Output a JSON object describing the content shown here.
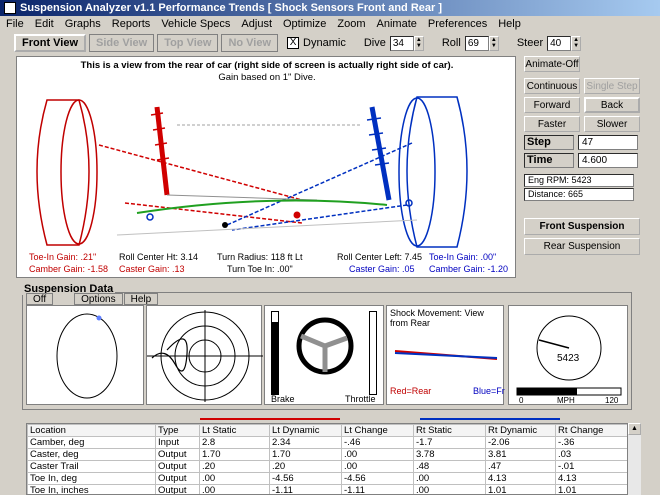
{
  "window": {
    "title": "Suspension Analyzer v1.1    Performance Trends   [ Shock Sensors Front and Rear ]"
  },
  "menu": [
    "File",
    "Edit",
    "Graphs",
    "Reports",
    "Vehicle Specs",
    "Adjust",
    "Optimize",
    "Zoom",
    "Animate",
    "Preferences",
    "Help"
  ],
  "toolbar": {
    "views": [
      {
        "label": "Front View",
        "state": "active"
      },
      {
        "label": "Side View",
        "state": "disabled"
      },
      {
        "label": "Top View",
        "state": "disabled"
      },
      {
        "label": "No View",
        "state": "disabled"
      }
    ],
    "dynamic_label": "Dynamic",
    "dynamic_checked": "X",
    "dive_label": "Dive",
    "dive_value": "34",
    "roll_label": "Roll",
    "roll_value": "69",
    "steer_label": "Steer",
    "steer_value": "40"
  },
  "viewport": {
    "caption1": "This is a view from the rear of car (right side of screen is actually right side of car).",
    "caption2": "Gain based on 1\" Dive.",
    "labels": {
      "toe_in_left": "Toe-In Gain: .21\"",
      "camber_left": "Camber Gain: -1.58",
      "roll_center_ht": "Roll Center Ht: 3.14",
      "caster_left": "Caster Gain: .13",
      "turn_radius": "Turn Radius: 118 ft Lt",
      "turn_toe": "Turn Toe In: .00\"",
      "roll_center_left": "Roll Center Left: 7.45",
      "caster_right": "Caster Gain: .05",
      "toe_in_right": "Toe-In Gain: .00\"",
      "camber_right": "Camber Gain: -1.20"
    }
  },
  "controls": {
    "animate_off": "Animate-Off",
    "continuous": "Continuous",
    "single_step": "Single Step",
    "forward": "Forward",
    "back": "Back",
    "faster": "Faster",
    "slower": "Slower",
    "step_label": "Step",
    "step_value": "47",
    "time_label": "Time",
    "time_value": "4.600",
    "eng_rpm": "Eng RPM:      5423",
    "distance": "Distance:  665",
    "front_suspension": "Front Suspension",
    "rear_suspension": "Rear Suspension"
  },
  "suspension_data": {
    "title": "Suspension Data",
    "tabs": [
      "Off",
      "Options",
      "Help"
    ],
    "brake_label": "Brake",
    "throttle_label": "Throttle",
    "brake_level": 0.88,
    "throttle_level": 0.0,
    "shock_title": "Shock Movement:  View from Rear",
    "shock_red": "Red=Rear",
    "shock_blue": "Blue=Fr",
    "rpm_value": "5423",
    "mph_min": "0",
    "mph_label": "MPH",
    "mph_max": "120"
  },
  "table": {
    "headers": [
      "Location",
      "Type",
      "Lt Static",
      "Lt Dynamic",
      "Lt Change",
      "Rt Static",
      "Rt Dynamic",
      "Rt Change"
    ],
    "rows": [
      [
        "Camber, deg",
        "Input",
        "2.8",
        "2.34",
        "-.46",
        "-1.7",
        "-2.06",
        "-.36"
      ],
      [
        "Caster, deg",
        "Output",
        "1.70",
        "1.70",
        ".00",
        "3.78",
        "3.81",
        ".03"
      ],
      [
        "Caster Trail",
        "Output",
        ".20",
        ".20",
        ".00",
        ".48",
        ".47",
        "-.01"
      ],
      [
        "Toe In, deg",
        "Output",
        ".00",
        "-4.56",
        "-4.56",
        ".00",
        "4.13",
        "4.13"
      ],
      [
        "Toe In, inches",
        "Output",
        ".00",
        "-1.11",
        "-1.11",
        ".00",
        "1.01",
        "1.01"
      ]
    ]
  },
  "colors": {
    "left_side": "#d00000",
    "right_side": "#0030c0",
    "title_bar": "#0a246a"
  }
}
